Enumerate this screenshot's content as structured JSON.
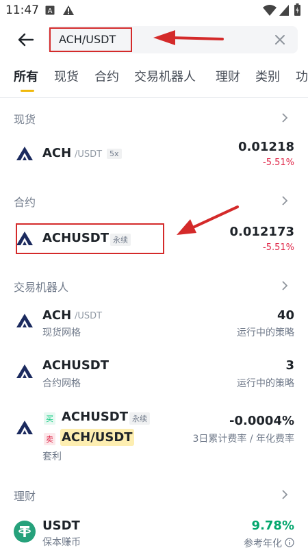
{
  "status_bar": {
    "time": "11:47"
  },
  "search": {
    "value": "ACH/USDT"
  },
  "tabs": [
    "所有",
    "现货",
    "合约",
    "交易机器人",
    "理财",
    "类别",
    "功"
  ],
  "spot": {
    "title": "现货",
    "name": "ACH",
    "quote": "/USDT",
    "leverage": "5x",
    "price": "0.01218",
    "change": "-5.51%"
  },
  "futures": {
    "title": "合约",
    "name": "ACHUSDT",
    "badge": "永续",
    "price": "0.012173",
    "change": "-5.51%"
  },
  "bots": {
    "title": "交易机器人",
    "items": [
      {
        "name": "ACH",
        "quote": "/USDT",
        "sub": "现货网格",
        "value": "40",
        "label": "运行中的策略"
      },
      {
        "name": "ACHUSDT",
        "sub": "合约网格",
        "value": "3",
        "label": "运行中的策略"
      },
      {
        "buy_tag": "买",
        "sell_tag": "卖",
        "name": "ACHUSDT",
        "badge": "永续",
        "name2": "ACH/USDT",
        "sub": "套利",
        "value": "-0.0004%",
        "label": "3日累计费率 / 年化费率"
      }
    ]
  },
  "earn": {
    "title": "理财",
    "name": "USDT",
    "sub": "保本赚币",
    "value": "9.78%",
    "label": "参考年化"
  },
  "colors": {
    "accent": "#f0b90b",
    "down": "#e0294a",
    "up": "#03a66d",
    "annotation": "#d42a2a"
  }
}
